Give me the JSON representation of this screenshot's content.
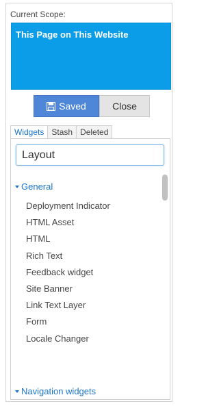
{
  "scope": {
    "label": "Current Scope:",
    "value": "This Page on This Website"
  },
  "buttons": {
    "saved_label": "Saved",
    "close_label": "Close"
  },
  "tabs": [
    {
      "label": "Widgets"
    },
    {
      "label": "Stash"
    },
    {
      "label": "Deleted"
    }
  ],
  "search": {
    "value": "Layout"
  },
  "groups": [
    {
      "label": "General"
    },
    {
      "label": "Navigation widgets"
    }
  ],
  "items": [
    {
      "label": "Deployment Indicator"
    },
    {
      "label": "HTML Asset"
    },
    {
      "label": "HTML"
    },
    {
      "label": "Rich Text"
    },
    {
      "label": "Feedback widget"
    },
    {
      "label": "Site Banner"
    },
    {
      "label": "Link Text Layer"
    },
    {
      "label": "Form"
    },
    {
      "label": "Locale Changer"
    }
  ],
  "colors": {
    "scope_bg": "#0b9de8",
    "saved_bg": "#4f87d8",
    "link_blue": "#1b75c9"
  },
  "icons": {
    "saved": "floppy-disk-icon",
    "group_toggle": "caret-down-icon"
  }
}
